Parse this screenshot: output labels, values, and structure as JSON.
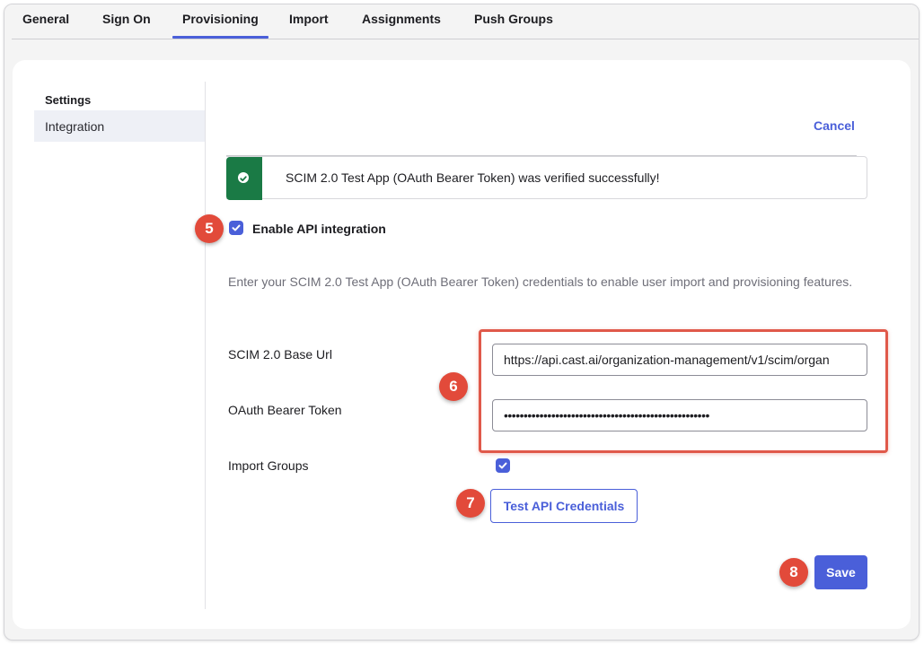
{
  "tabs": [
    {
      "label": "General"
    },
    {
      "label": "Sign On"
    },
    {
      "label": "Provisioning"
    },
    {
      "label": "Import"
    },
    {
      "label": "Assignments"
    },
    {
      "label": "Push Groups"
    }
  ],
  "sidebar": {
    "title": "Settings",
    "items": [
      {
        "label": "Integration"
      }
    ]
  },
  "main": {
    "cancel_label": "Cancel",
    "banner_text": "SCIM 2.0 Test App (OAuth Bearer Token) was verified successfully!",
    "enable_api_label": "Enable API integration",
    "description": "Enter your SCIM 2.0 Test App (OAuth Bearer Token) credentials to enable user import and provisioning features.",
    "base_url_label": "SCIM 2.0 Base Url",
    "base_url_value": "https://api.cast.ai/organization-management/v1/scim/organ",
    "token_label": "OAuth Bearer Token",
    "token_value": "••••••••••••••••••••••••••••••••••••••••••••••••••••",
    "import_groups_label": "Import Groups",
    "test_button_label": "Test API Credentials",
    "save_label": "Save"
  },
  "annotations": [
    "5",
    "6",
    "7",
    "8"
  ],
  "colors": {
    "accent": "#4a5fd9",
    "success": "#1a7a45",
    "annotation": "#e24a3a"
  }
}
